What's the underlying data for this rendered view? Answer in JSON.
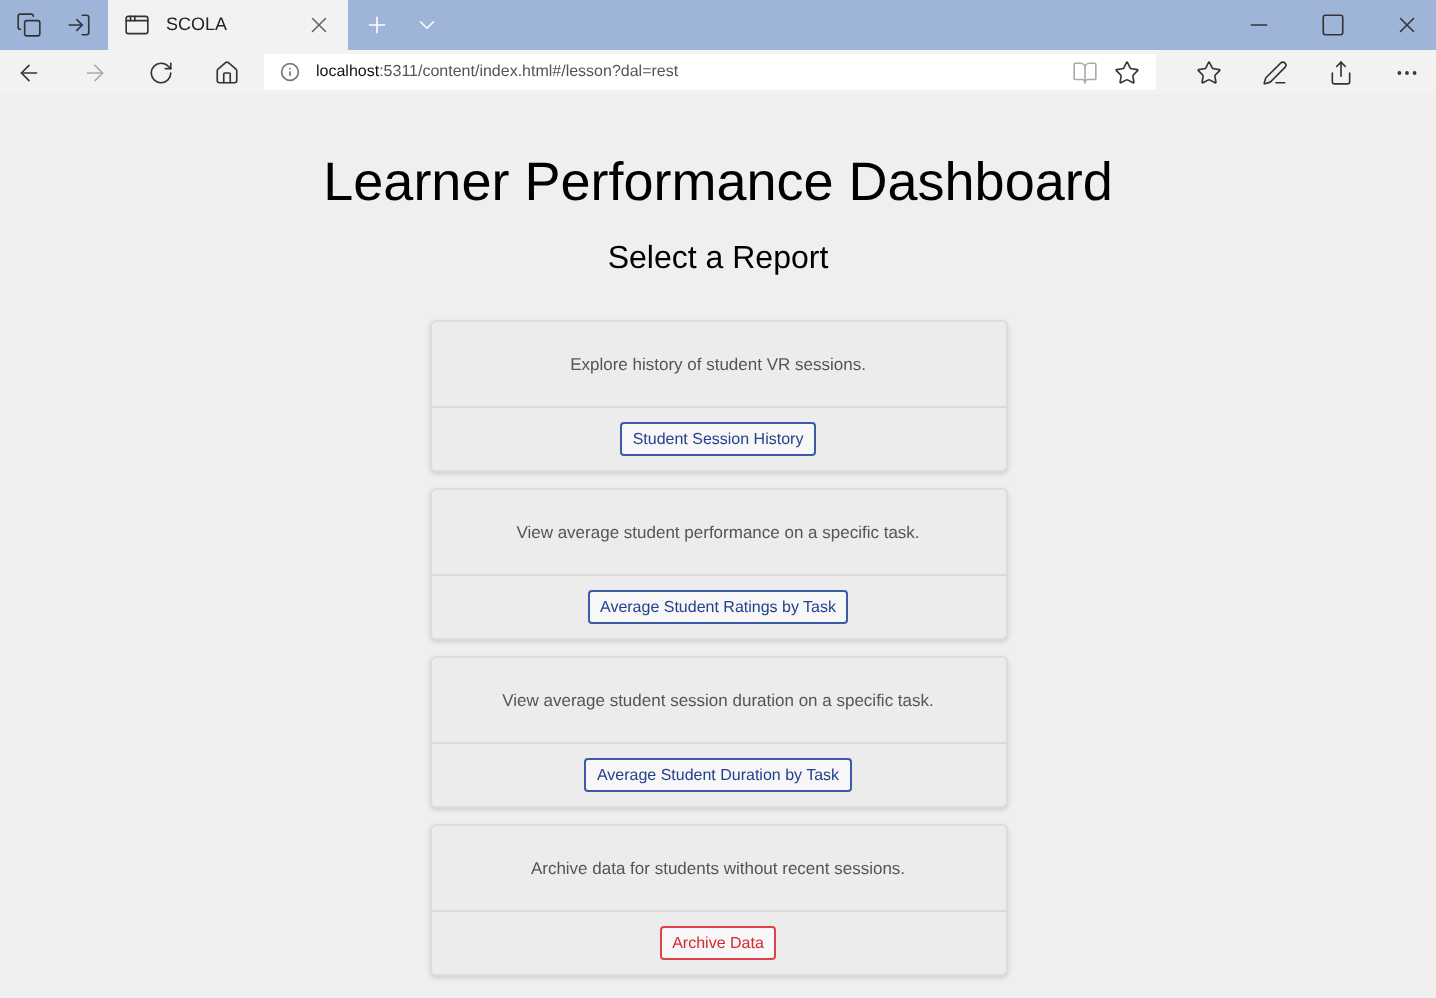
{
  "browser": {
    "tab_title": "SCOLA",
    "url_host": "localhost",
    "url_rest": ":5311/content/index.html#/lesson?dal=rest"
  },
  "page": {
    "title": "Learner Performance Dashboard",
    "subtitle": "Select a Report"
  },
  "reports": [
    {
      "description": "Explore history of student VR sessions.",
      "button": "Student Session History",
      "kind": "primary"
    },
    {
      "description": "View average student performance on a specific task.",
      "button": "Average Student Ratings by Task",
      "kind": "primary"
    },
    {
      "description": "View average student session duration on a specific task.",
      "button": "Average Student Duration by Task",
      "kind": "primary"
    },
    {
      "description": "Archive data for students without recent sessions.",
      "button": "Archive Data",
      "kind": "danger"
    }
  ]
}
